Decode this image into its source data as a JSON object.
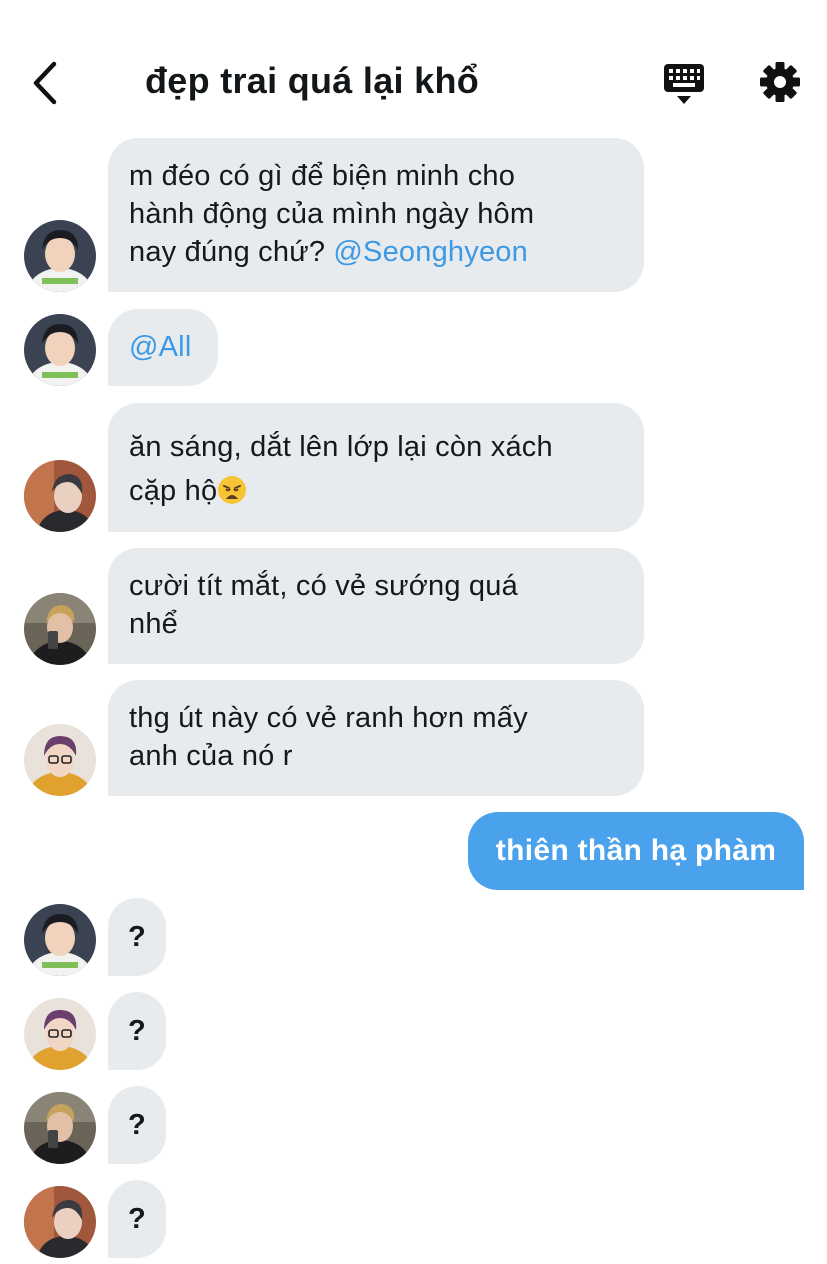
{
  "header": {
    "title": "đẹp trai quá lại khổ",
    "back_icon": "chevron-left-icon",
    "keyboard_icon": "keyboard-icon",
    "settings_icon": "gear-icon"
  },
  "messages": [
    {
      "sender": "member-1",
      "line1": "m đéo có gì để biện minh cho",
      "line2": "hành động của mình ngày hôm",
      "line3": "nay đúng chứ?",
      "mention": "@Seonghyeon"
    },
    {
      "sender": "member-1",
      "mention": "@All"
    },
    {
      "sender": "member-2",
      "line1": "ăn sáng, dắt lên lớp lại còn xách",
      "line2": "cặp hộ",
      "emoji": "weary-face-emoji"
    },
    {
      "sender": "member-3",
      "line1": "cười tít mắt, có vẻ sướng quá",
      "line2": "nhể"
    },
    {
      "sender": "member-4",
      "line1": "thg út này có vẻ ranh hơn mấy",
      "line2": "anh của nó r"
    },
    {
      "sender": "me",
      "text": "thiên thần hạ phàm"
    },
    {
      "sender": "member-1",
      "text": "?"
    },
    {
      "sender": "member-4",
      "text": "?"
    },
    {
      "sender": "member-3",
      "text": "?"
    },
    {
      "sender": "member-2",
      "text": "?"
    }
  ],
  "colors": {
    "incoming_bubble": "#e8ebee",
    "outgoing_bubble": "#4aa1ec",
    "mention": "#3c99e6",
    "text": "#16191c"
  }
}
